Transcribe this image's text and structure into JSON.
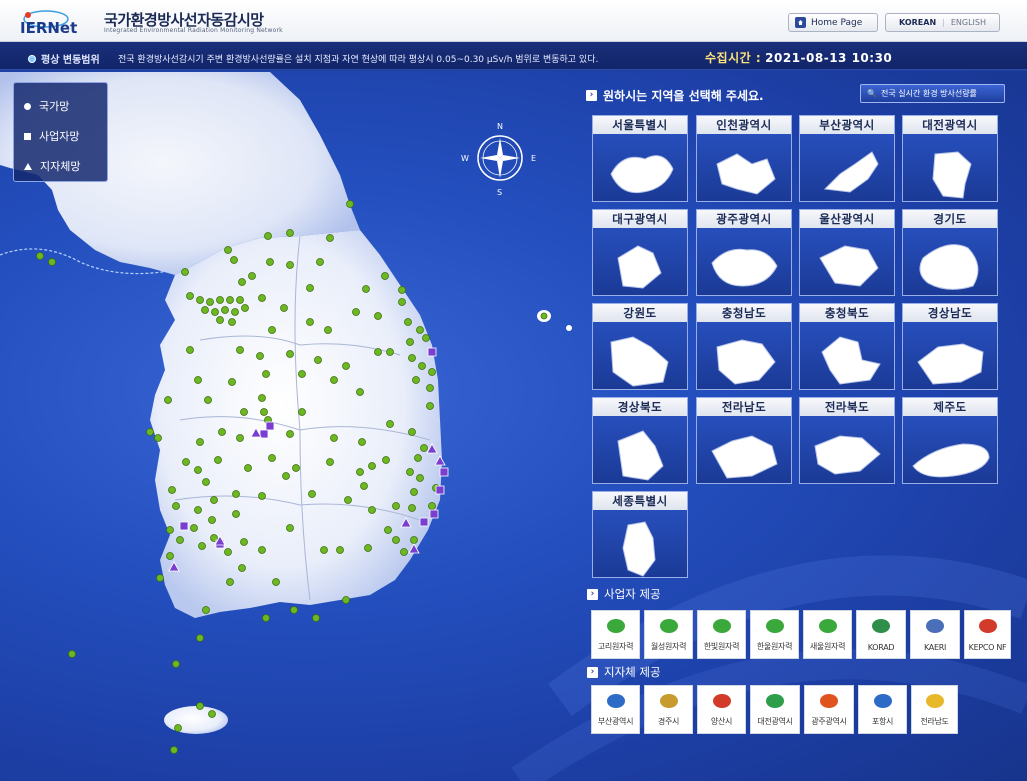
{
  "header": {
    "logo_text": "IERNet",
    "title": "국가환경방사선자동감시망",
    "subtitle": "Integrated Environmental Radiation Monitoring Network",
    "home_label": "Home Page",
    "lang_korean": "KOREAN",
    "lang_separator": "|",
    "lang_english": "ENGLISH"
  },
  "info": {
    "label": "평상 변동범위",
    "text": "전국 환경방사선감시기 주변 환경방사선량률은 설치 지점과 자연 현상에 따라 평상시 0.05~0.30 μSv/h 범위로 변동하고 있다.",
    "collect_label": "수집시간 :",
    "collect_time": "2021-08-13 10:30"
  },
  "legend": {
    "national": "국가망",
    "operator": "사업자망",
    "local": "지자체망"
  },
  "compass": {
    "n": "N",
    "s": "S",
    "e": "E",
    "w": "W"
  },
  "regions": {
    "header": "원하시는 지역을 선택해 주세요.",
    "nationwide_button": "전국 실시간 환경 방사선량률",
    "tiles": [
      "서울특별시",
      "인천광역시",
      "부산광역시",
      "대전광역시",
      "대구광역시",
      "광주광역시",
      "울산광역시",
      "경기도",
      "강원도",
      "충청남도",
      "충청북도",
      "경상남도",
      "경상북도",
      "전라남도",
      "전라북도",
      "제주도",
      "세종특별시"
    ]
  },
  "operators": {
    "header": "사업자 제공",
    "items": [
      "고리원자력",
      "월성원자력",
      "한빛원자력",
      "한울원자력",
      "새울원자력",
      "KORAD",
      "KAERI",
      "KEPCO NF"
    ]
  },
  "locals": {
    "header": "지자체 제공",
    "items": [
      "부산광역시",
      "경주시",
      "양산시",
      "대전광역시",
      "광주광역시",
      "포항시",
      "전라남도"
    ]
  },
  "colors": {
    "station_green": "#6cb820",
    "station_purple": "#7a3fd0",
    "accent_yellow": "#ffe27a"
  }
}
